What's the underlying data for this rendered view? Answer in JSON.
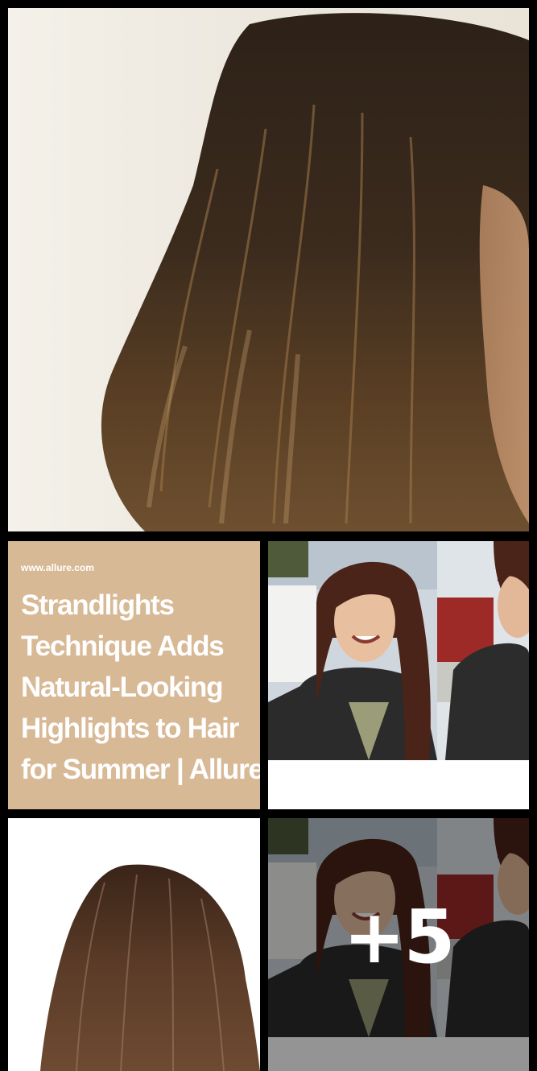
{
  "gallery": {
    "tiles": [
      {
        "kind": "photo",
        "subject": "long brown hair with highlights"
      },
      {
        "kind": "text-card",
        "site": "www.allure.com",
        "title": "Strandlights\nTechnique Adds\nNatural-Looking\nHighlights to Hair\nfor Summer | Allure"
      },
      {
        "kind": "photo",
        "subject": "selfie collage"
      },
      {
        "kind": "photo",
        "subject": "back of head, straight brown hair"
      },
      {
        "kind": "photo",
        "subject": "selfie collage",
        "more_count": "+5"
      }
    ],
    "colors": {
      "text_card_bg": "#d8b996",
      "overlay": "rgba(0,0,0,0.42)"
    }
  }
}
